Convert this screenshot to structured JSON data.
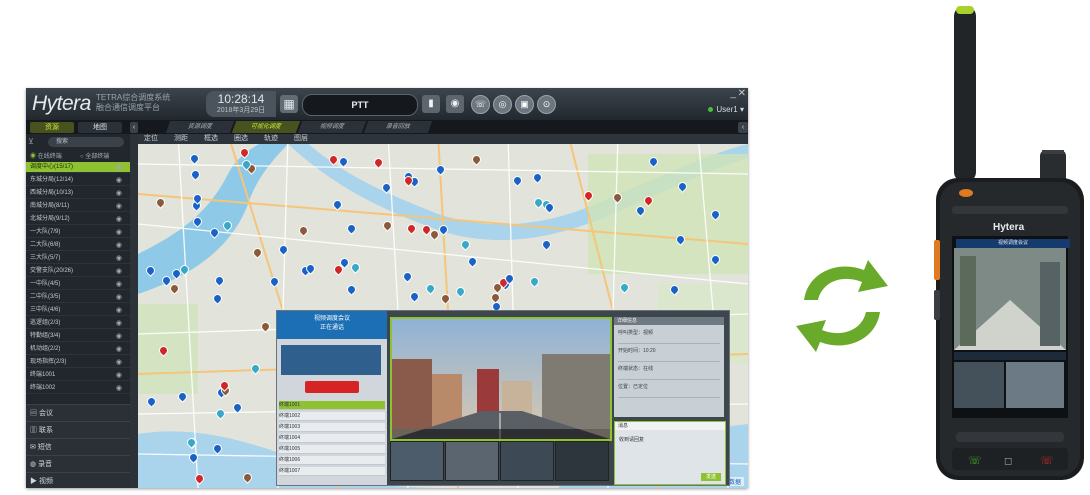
{
  "console": {
    "brand": "Hytera",
    "tagline_line1": "TETRA综合调度系统",
    "tagline_line2": "融合通信调度平台",
    "clock_time": "10:28:14",
    "clock_date": "2018年3月29日",
    "ptt_label": "PTT",
    "user_label": "User1",
    "left_tabs": [
      "资源",
      "地图"
    ],
    "main_tabs": [
      {
        "label": "资源调度",
        "active": false
      },
      {
        "label": "可视化调度",
        "active": true
      },
      {
        "label": "视频调度",
        "active": false
      },
      {
        "label": "录音回放",
        "active": false
      }
    ],
    "search_placeholder": "搜索",
    "radio_opts": [
      "在线终端",
      "全部终端"
    ],
    "tree": [
      {
        "label": "调度中心(15/17)",
        "selected": true
      },
      {
        "label": "东城分局(12/14)",
        "selected": false
      },
      {
        "label": "西城分局(10/13)",
        "selected": false
      },
      {
        "label": "南城分局(8/11)",
        "selected": false
      },
      {
        "label": "北城分局(9/12)",
        "selected": false
      },
      {
        "label": "一大队(7/9)",
        "selected": false
      },
      {
        "label": "二大队(6/8)",
        "selected": false
      },
      {
        "label": "三大队(5/7)",
        "selected": false
      },
      {
        "label": "交警支队(20/26)",
        "selected": false
      },
      {
        "label": "一中队(4/5)",
        "selected": false
      },
      {
        "label": "二中队(3/5)",
        "selected": false
      },
      {
        "label": "三中队(4/6)",
        "selected": false
      },
      {
        "label": "巡逻组(2/3)",
        "selected": false
      },
      {
        "label": "特勤组(3/4)",
        "selected": false
      },
      {
        "label": "机动组(2/2)",
        "selected": false
      },
      {
        "label": "现场指挥(2/3)",
        "selected": false
      },
      {
        "label": "终端1001",
        "selected": false
      },
      {
        "label": "终端1002",
        "selected": false
      }
    ],
    "bottom_nav": [
      "会议",
      "联系",
      "短信",
      "录音",
      "视频"
    ],
    "map_tools": [
      "定位",
      "测距",
      "框选",
      "圈选",
      "轨迹",
      "图层"
    ],
    "map_credit": "地图数据",
    "call": {
      "title": "视频调度会议",
      "subtitle": "正在通话",
      "members": [
        "终端1001",
        "终端1002",
        "终端1003",
        "终端1004",
        "终端1005",
        "终端1006",
        "终端1007"
      ],
      "info_header": "详细信息",
      "info_rows": [
        "呼叫类型：视频",
        "开始时间：10:20",
        "终端状态：在线",
        "位置：已定位"
      ],
      "chat_header": "消息",
      "chat_text": "收到请回复",
      "send_label": "发送"
    }
  },
  "radio": {
    "brand": "Hytera",
    "screen_title": "视频调度会议"
  },
  "colors": {
    "accent_green": "#8fc231",
    "pin_blue": "#1a62c6",
    "pin_teal": "#38a8c8",
    "pin_brown": "#8a5a3a",
    "pin_red": "#d02828",
    "arrow_green": "#6aaa2a"
  }
}
